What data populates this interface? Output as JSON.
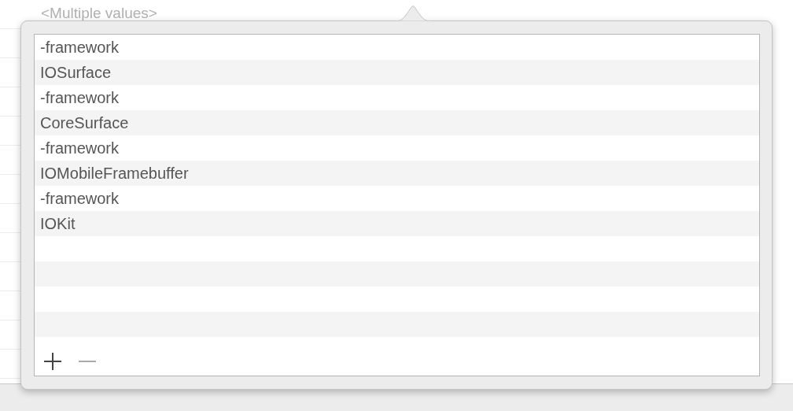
{
  "field": {
    "value": "<Multiple values>"
  },
  "list": {
    "items": [
      "-framework",
      "IOSurface",
      "-framework",
      "CoreSurface",
      "-framework",
      "IOMobileFramebuffer",
      "-framework",
      "IOKit"
    ]
  },
  "buttons": [
    {
      "kind": "add",
      "disabled": false
    },
    {
      "kind": "remove",
      "disabled": true
    }
  ]
}
